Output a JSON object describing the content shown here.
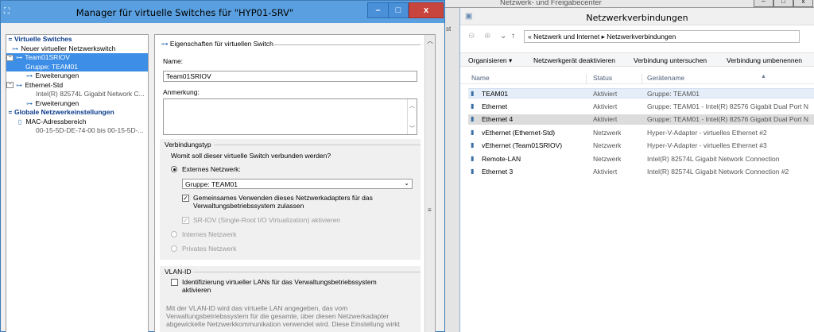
{
  "vsm": {
    "title": "Manager für virtuelle Switches für \"HYP01-SRV\"",
    "tree": {
      "virtual_switches": "Virtuelle Switches",
      "new_switch": "Neuer virtueller Netzwerkswitch",
      "team_switch": "Team01SRIOV",
      "team_switch_sub": "Gruppe: TEAM01",
      "extensions_1": "Erweiterungen",
      "eth_switch": "Ethernet-Std",
      "eth_switch_sub": "Intel(R) 82574L Gigabit Network C...",
      "extensions_2": "Erweiterungen",
      "global": "Globale Netzwerkeinstellungen",
      "mac": "MAC-Adressbereich",
      "mac_sub": "00-15-5D-DE-74-00 bis 00-15-5D-..."
    },
    "props": {
      "header": "Eigenschaften für virtuellen Switch",
      "name_label": "Name:",
      "name_value": "Team01SRIOV",
      "note_label": "Anmerkung:",
      "conn_type_title": "Verbindungstyp",
      "conn_question": "Womit soll dieser virtuelle Switch verbunden werden?",
      "external": "Externes Netzwerk:",
      "adapter_select": "Gruppe: TEAM01",
      "shared_line1": "Gemeinsames Verwenden dieses Netzwerkadapters für das",
      "shared_line2": "Verwaltungsbetriebssystem zulassen",
      "sriov": "SR-IOV (Single-Root I/O Virtualization) aktivieren",
      "internal": "Internes Netzwerk",
      "private": "Privates Netzwerk",
      "vlan_title": "VLAN-ID",
      "vlan_line1": "Identifizierung virtueller LANs für das Verwaltungsbetriebssystem",
      "vlan_line2": "aktivieren",
      "vlan_desc1": "Mit der VLAN-ID wird das virtuelle LAN angegeben, das vom",
      "vlan_desc2": "Verwaltungsbetriebssystem für die gesamte, über diesen Netzwerkadapter",
      "vlan_desc3": "abgewickelte Netzwerkkommunikation verwendet wird. Diese Einstellung wirkt"
    },
    "buttons": {
      "min": "–",
      "max": "□",
      "close": "x"
    }
  },
  "behind": {
    "title": "Netzwerk- und Freigabecenter",
    "min": "–",
    "max": "□",
    "close": "x",
    "side_text": "st"
  },
  "nc": {
    "title": "Netzwerkverbindungen",
    "address": "« Netzwerk und Internet  ▸  Netzwerkverbindungen",
    "toolbar": {
      "organize": "Organisieren ▾",
      "deactivate": "Netzwerkgerät deaktivieren",
      "diagnose": "Verbindung untersuchen",
      "rename": "Verbindung umbenennen"
    },
    "columns": {
      "name": "Name",
      "status": "Status",
      "device": "Gerätename"
    },
    "rows": [
      {
        "name": "TEAM01",
        "status": "Aktiviert",
        "device": "Gruppe: TEAM01"
      },
      {
        "name": "Ethernet",
        "status": "Aktiviert",
        "device": "Gruppe: TEAM01 - Intel(R) 82576 Gigabit Dual Port N"
      },
      {
        "name": "Ethernet 4",
        "status": "Aktiviert",
        "device": "Gruppe: TEAM01 - Intel(R) 82576 Gigabit Dual Port N"
      },
      {
        "name": "vEthernet (Ethernet-Std)",
        "status": "Netzwerk",
        "device": "Hyper-V-Adapter - virtuelles Ethernet #2"
      },
      {
        "name": "vEthernet (Team01SRIOV)",
        "status": "Netzwerk",
        "device": "Hyper-V-Adapter - virtuelles Ethernet #3"
      },
      {
        "name": "Remote-LAN",
        "status": "Netzwerk",
        "device": "Intel(R) 82574L Gigabit Network Connection"
      },
      {
        "name": "Ethernet 3",
        "status": "Aktiviert",
        "device": "Intel(R) 82574L Gigabit Network Connection #2"
      }
    ]
  }
}
